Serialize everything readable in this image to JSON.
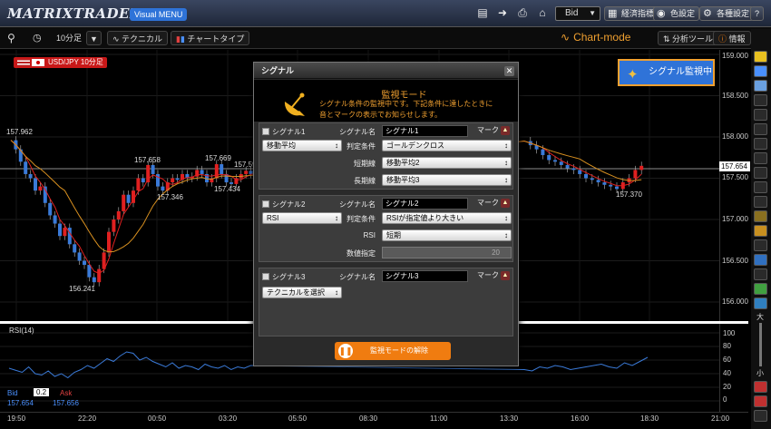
{
  "topbar": {
    "logo": "MATRIXTRADER",
    "visual_menu": "Visual MENU",
    "price_type": "Bid",
    "economic_indicators": "経済指標",
    "color_settings": "色設定",
    "settings": "各種設定",
    "help": "?"
  },
  "toolbar": {
    "timeframe": "10分足",
    "technical": "テクニカル",
    "chart_type": "チャートタイプ",
    "chart_mode": "Chart-mode",
    "analysis_tools": "分析ツール",
    "info": "情報",
    "panel_number": "1"
  },
  "symbol": {
    "label": "USD/JPY 10分足"
  },
  "price_axis": {
    "labels": [
      "159.000",
      "158.500",
      "158.000",
      "157.500",
      "157.000",
      "156.500",
      "156.000"
    ],
    "current": "157.654"
  },
  "annotations": [
    "157.962",
    "157.658",
    "157.346",
    "157.669",
    "157.434",
    "157.59",
    "156.241",
    "157.370"
  ],
  "rsi": {
    "label": "RSI(14)",
    "axis": [
      "100",
      "80",
      "60",
      "40",
      "20",
      "0"
    ]
  },
  "quote": {
    "bid_label": "Bid",
    "spread": "0.2",
    "ask_label": "Ask",
    "bid_value": "157.654",
    "ask_value": "157.656"
  },
  "time_axis": [
    "19:50",
    "22:20",
    "00:50",
    "03:20",
    "05:50",
    "08:30",
    "11:00",
    "13:30",
    "16:00",
    "18:30",
    "21:00"
  ],
  "signal_monitor_button": "シグナル監視中",
  "side_tools": {
    "zoom_in": "大",
    "zoom_out": "小"
  },
  "dialog": {
    "title": "シグナル",
    "header_title": "監視モード",
    "description_line1": "シグナル条件の監視中です。下記条件に達したときに",
    "description_line2": "音とマークの表示でお知らせします。",
    "signals": [
      {
        "id": "シグナル1",
        "name_label": "シグナル名",
        "name": "シグナル1",
        "mark": "マーク",
        "indicator": "移動平均",
        "condition_label": "判定条件",
        "condition": "ゴールデンクロス",
        "short_label": "短期線",
        "short": "移動平均2",
        "long_label": "長期線",
        "long": "移動平均3"
      },
      {
        "id": "シグナル2",
        "name_label": "シグナル名",
        "name": "シグナル2",
        "mark": "マーク",
        "indicator": "RSI",
        "condition_label": "判定条件",
        "condition": "RSIが指定値より大きい",
        "rsi_label": "RSI",
        "rsi": "短期",
        "value_label": "数値指定",
        "value": "20"
      },
      {
        "id": "シグナル3",
        "name_label": "シグナル名",
        "name": "シグナル3",
        "mark": "マーク",
        "indicator": "テクニカルを選択"
      }
    ],
    "stop_button": "監視モードの解除"
  }
}
